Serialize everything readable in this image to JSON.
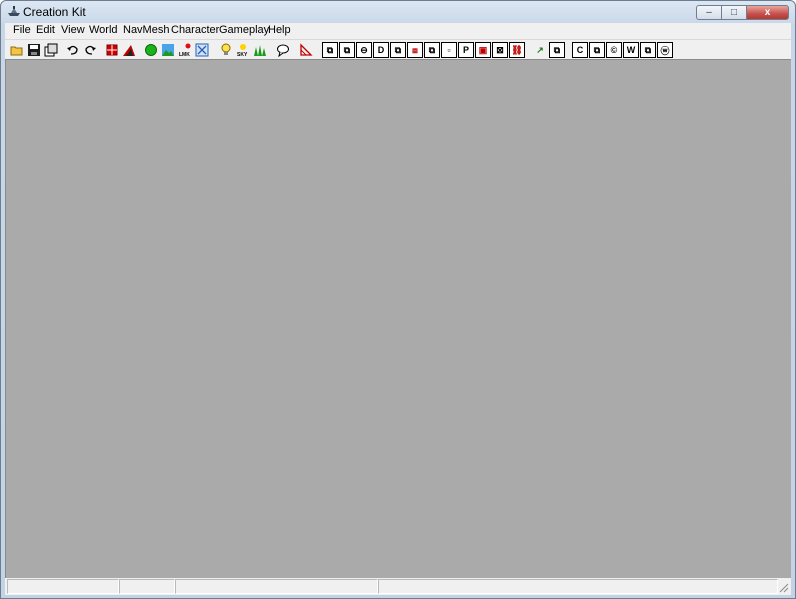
{
  "window": {
    "title": "Creation Kit",
    "caption": {
      "minimize_glyph": "‒",
      "maximize_glyph": "□",
      "close_glyph": "x"
    }
  },
  "menu": [
    "File",
    "Edit",
    "View",
    "World",
    "NavMesh",
    "Character",
    "Gameplay",
    "Help"
  ],
  "toolbar": {
    "buttons": [
      {
        "name": "open-icon"
      },
      {
        "name": "save-icon"
      },
      {
        "name": "preferences-icon"
      },
      {
        "name": "undo-icon"
      },
      {
        "name": "redo-icon"
      },
      {
        "name": "render-window-icon"
      },
      {
        "name": "terrain-icon"
      },
      {
        "name": "green-sphere-icon"
      },
      {
        "name": "landscape-icon"
      },
      {
        "name": "lmk-icon"
      },
      {
        "name": "light-marker-icon"
      },
      {
        "name": "light-bulb-icon"
      },
      {
        "name": "sky-icon"
      },
      {
        "name": "grass-icon"
      },
      {
        "name": "speech-bubble-icon"
      },
      {
        "name": "navmesh-icon"
      }
    ],
    "boxed_buttons": [
      {
        "name": "cube-a-icon",
        "glyph": "⧉"
      },
      {
        "name": "cube-b-icon",
        "glyph": "⧉"
      },
      {
        "name": "circle-minus-icon",
        "glyph": "⊖"
      },
      {
        "name": "letter-d-icon",
        "glyph": "D"
      },
      {
        "name": "cube-c-icon",
        "glyph": "⧉"
      },
      {
        "name": "split-icon",
        "glyph": "⧈"
      },
      {
        "name": "cube-d-icon",
        "glyph": "⧉"
      },
      {
        "name": "square-icon",
        "glyph": "▫"
      },
      {
        "name": "letter-p-icon",
        "glyph": "P"
      },
      {
        "name": "red-box-icon",
        "glyph": "▣"
      },
      {
        "name": "crossed-box-icon",
        "glyph": "⊠"
      },
      {
        "name": "link-icon",
        "glyph": "⛓"
      },
      {
        "name": "arrow-icon",
        "glyph": "↗"
      },
      {
        "name": "cube-e-icon",
        "glyph": "⧉"
      },
      {
        "name": "letter-c-icon",
        "glyph": "C"
      },
      {
        "name": "cube-f-icon",
        "glyph": "⧉"
      },
      {
        "name": "circle-c-icon",
        "glyph": "©"
      },
      {
        "name": "letter-w-icon",
        "glyph": "W"
      },
      {
        "name": "cube-g-icon",
        "glyph": "⧉"
      },
      {
        "name": "circle-w-icon",
        "glyph": "ⓦ"
      }
    ]
  },
  "status_bar": {
    "panes": [
      "",
      "",
      "",
      "",
      ""
    ]
  },
  "colors": {
    "workspace": "#aaaaaa",
    "chrome": "#f0f0f0",
    "frame": "#c8d7e8"
  }
}
